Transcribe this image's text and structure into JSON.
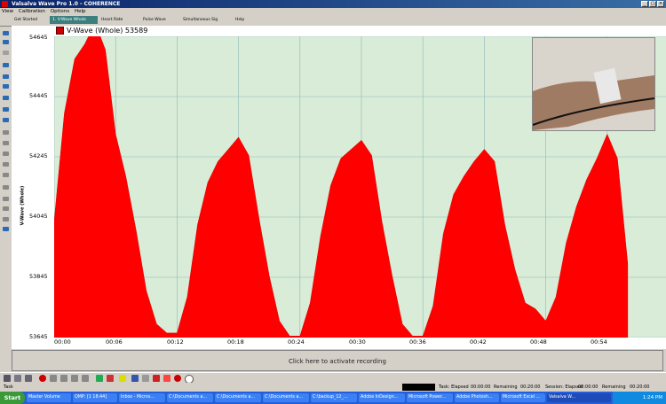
{
  "window": {
    "title": "Valsalva Wave Pro 1.0 - COHERENCE"
  },
  "menu": [
    "View",
    "Calibration",
    "Options",
    "Help"
  ],
  "tabs": [
    "Get Started",
    "1. V-Wave Whole",
    "Heart Rate",
    "Pulse Wave",
    "Simultaneous Sig",
    "Help"
  ],
  "chart": {
    "title": "V-Wave (Whole)  53589",
    "ylabel": "V-Wave (Whole)",
    "yticks": [
      "54645",
      "54445",
      "54245",
      "54045",
      "53845",
      "53645"
    ],
    "xticks": [
      "00:00",
      "00:06",
      "00:12",
      "00:18",
      "00:24",
      "00:30",
      "00:36",
      "00:42",
      "00:48",
      "00:54"
    ]
  },
  "chart_data": {
    "type": "area",
    "title": "V-Wave (Whole)  53589",
    "ylabel": "V-Wave (Whole)",
    "xlabel": "",
    "x_unit": "seconds",
    "ylim": [
      53645,
      54645
    ],
    "xlim": [
      0,
      60
    ],
    "grid": true,
    "color": "#ff0000",
    "x": [
      0,
      1,
      2,
      3,
      4,
      5,
      6,
      7,
      8,
      9,
      10,
      11,
      12,
      13,
      14,
      15,
      16,
      17,
      18,
      19,
      20,
      21,
      22,
      23,
      24,
      25,
      26,
      27,
      28,
      29,
      30,
      31,
      32,
      33,
      34,
      35,
      36,
      37,
      38,
      39,
      40,
      41,
      42,
      43,
      44,
      45,
      46,
      47,
      48,
      49,
      50,
      51,
      52,
      53,
      54,
      55,
      56
    ],
    "values": [
      54030,
      54390,
      54570,
      54620,
      54690,
      54600,
      54320,
      54180,
      54000,
      53800,
      53690,
      53660,
      53660,
      53780,
      54020,
      54160,
      54230,
      54270,
      54310,
      54250,
      54040,
      53850,
      53700,
      53650,
      53650,
      53760,
      53980,
      54150,
      54240,
      54270,
      54300,
      54250,
      54030,
      53850,
      53690,
      53650,
      53650,
      53750,
      53990,
      54120,
      54180,
      54230,
      54270,
      54230,
      54020,
      53870,
      53760,
      53740,
      53700,
      53780,
      53960,
      54080,
      54170,
      54240,
      54320,
      54240,
      53890
    ]
  },
  "record": {
    "label": "Click here to activate recording"
  },
  "status": {
    "task": "Task",
    "task_elapsed_label": "Task: Elapsed",
    "task_elapsed": "00:00:00",
    "remaining_label": "Remaining",
    "task_remaining": "00:20:00",
    "session_label": "Session: Elapsed",
    "session_elapsed": "00:00:00",
    "session_remaining": "00:20:00"
  },
  "taskbar": {
    "start": "Start",
    "items": [
      "Master Volume",
      "QMP: [1 18:44]",
      "Inbox - Micros...",
      "C:\\Documents a...",
      "C:\\Documents a...",
      "C:\\Documents a...",
      "C:\\backup_12_...",
      "Adobe InDesign...",
      "Microsoft Power...",
      "Adobe Photosh...",
      "Microsoft Excel ...",
      "Valsalva W..."
    ],
    "clock": "1:24 PM"
  }
}
